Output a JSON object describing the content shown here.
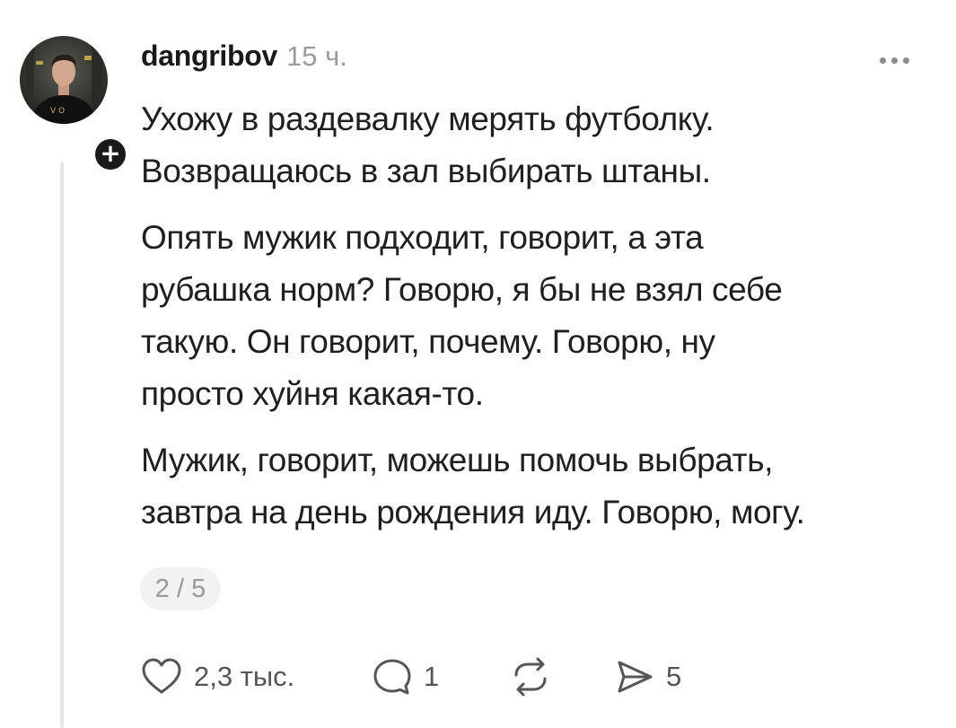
{
  "post": {
    "author": "dangribov",
    "time": "15 ч.",
    "follow_glyph": "+",
    "paragraphs": [
      "Ухожу в раздевалку мерять футболку.\nВозвращаюсь в зал выбирать штаны.",
      "Опять мужик подходит, говорит, а эта\nрубашка норм? Говорю, я бы не взял себе\nтакую. Он говорит, почему. Говорю, ну\nпросто хуйня какая-то.",
      "Мужик, говорит, можешь помочь выбрать,\nзавтра на день рождения иду. Говорю, могу."
    ],
    "pager": "2 / 5"
  },
  "actions": {
    "like": {
      "icon": "heart-icon",
      "count": "2,3 тыс."
    },
    "comment": {
      "icon": "comment-icon",
      "count": "1"
    },
    "repost": {
      "icon": "repost-icon",
      "count": ""
    },
    "share": {
      "icon": "share-icon",
      "count": "5"
    }
  },
  "icons": {
    "more": "more-dots-icon"
  },
  "colors": {
    "text": "#1f1f1f",
    "muted": "#9b9b9b",
    "thread_line": "#e6e6e6",
    "pill_bg": "#f2f2f2"
  }
}
